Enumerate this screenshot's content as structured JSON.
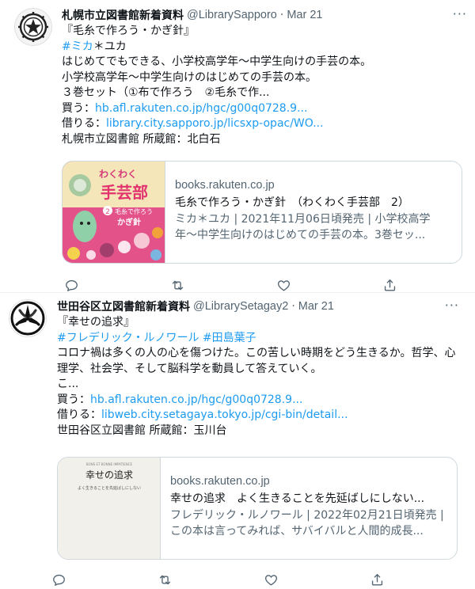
{
  "tweets": [
    {
      "author_name": "札幌市立図書館新着資料",
      "handle": "@LibrarySapporo",
      "separator": "·",
      "date": "Mar 21",
      "more": "···",
      "avatar_icon": "sapporo-emblem-icon",
      "lines": {
        "title": "『毛糸で作ろう・かぎ針』",
        "hashtag": "#ミカ",
        "author_rest": "＊ユカ",
        "desc1": "はじめてでもできる、小学校高学年〜中学生向けの手芸の本。",
        "desc2": "小学校高学年〜中学生向けのはじめての手芸の本。",
        "desc3": "３巻セット（①布で作ろう　②毛糸で作...",
        "buy_label": "買う：",
        "buy_link": "hb.afl.rakuten.co.jp/hgc/g00q0728.9...",
        "borrow_label": "借りる：",
        "borrow_link": "library.city.sapporo.jp/licsxp-opac/WO...",
        "holding": "札幌市立図書館 所蔵館：北白石"
      },
      "card": {
        "domain": "books.rakuten.co.jp",
        "title": "毛糸で作ろう・かぎ針　（わくわく手芸部　2）",
        "description": "ミカ＊ユカ | 2021年11月06日頃発売 | 小学校高学年〜中学生向けのはじめての手芸の本。3巻セッ...",
        "cover_series": "わくわく",
        "cover_title": "手芸部",
        "cover_sub": "毛糸で作ろう",
        "cover_sub2": "かぎ針",
        "cover_num": "2"
      }
    },
    {
      "author_name": "世田谷区立図書館新着資料",
      "handle": "@LibrarySetagay2",
      "separator": "·",
      "date": "Mar 21",
      "more": "···",
      "avatar_icon": "setagaya-emblem-icon",
      "lines": {
        "title": "『幸せの追求』",
        "hashtags": "#フレデリック・ルノワール #田島葉子",
        "desc1": "コロナ禍は多くの人の心を傷つけた。この苦しい時期をどう生きるか。哲学、心理学、社会学、そして脳科学を動員して答えていく。",
        "desc2": "こ...",
        "buy_label": "買う：",
        "buy_link": "hb.afl.rakuten.co.jp/hgc/g00q0728.9...",
        "borrow_label": "借りる：",
        "borrow_link": "libweb.city.setagaya.tokyo.jp/cgi-bin/detail...",
        "holding": "世田谷区立図書館 所蔵館：玉川台"
      },
      "card": {
        "domain": "books.rakuten.co.jp",
        "title": "幸せの追求　よく生きることを先延ばしにしない...",
        "description": "フレデリック・ルノワール | 2022年02月21日頃発売 | この本は言ってみれば、サバイバルと人間的成長...",
        "cover_header": "BONS ET BONNE IMPATIENCE",
        "cover_title": "幸せの追求",
        "cover_sub": "よく生きることを先延ばしにしない"
      }
    }
  ],
  "actions": {
    "reply_icon": "reply-icon",
    "retweet_icon": "retweet-icon",
    "like_icon": "heart-icon",
    "share_icon": "share-icon"
  },
  "colors": {
    "link": "#1d9bf0",
    "secondary_text": "#536471",
    "border": "#cfd9de",
    "cover1_bg": "#e4528a",
    "cover2_bg": "#f2f0ea"
  }
}
